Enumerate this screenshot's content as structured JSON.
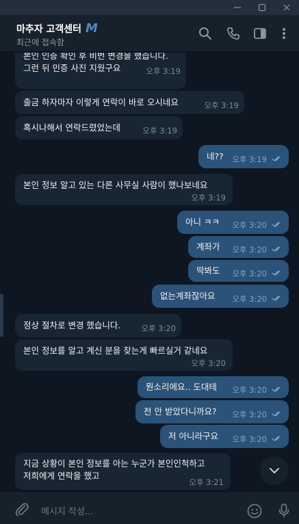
{
  "header": {
    "chat_name": "마추자 고객센터",
    "badge": "M",
    "status": "최근에 접속함"
  },
  "colors": {
    "background": "#0e1621",
    "incoming_bubble": "#182533",
    "outgoing_bubble": "#2b5278",
    "accent": "#5288c1"
  },
  "messages": [
    {
      "text": "본인 인증 확인 후 비번 변경을 했습니다.",
      "time": "",
      "dir": "in"
    },
    {
      "text": "그런 뒤 민증 사진 지웠구요",
      "time": "오후 3:19",
      "dir": "in"
    },
    {
      "text": "출금 하자마자 이렇게 연락이 바로 오시네요",
      "time": "오후 3:19",
      "dir": "in"
    },
    {
      "text": "혹시나해서 연락드렸었는데",
      "time": "오후 3:19",
      "dir": "in"
    },
    {
      "text": "네??",
      "time": "오후 3:19",
      "dir": "out"
    },
    {
      "text": "본인 정보 알고 있는 다른 사무실 사람이 했나보네요",
      "time": "오후 3:19",
      "dir": "in"
    },
    {
      "text": "아니 ㅋㅋ",
      "time": "오후 3:20",
      "dir": "out"
    },
    {
      "text": "계좌가",
      "time": "오후 3:20",
      "dir": "out"
    },
    {
      "text": "딱봐도",
      "time": "오후 3:20",
      "dir": "out"
    },
    {
      "text": "없는계좌잖아요",
      "time": "오후 3:20",
      "dir": "out"
    },
    {
      "text": "정상 절차로 변경 했습니다.",
      "time": "오후 3:20",
      "dir": "in"
    },
    {
      "text": "본인 정보를 알고 계신 분을 찾는게 빠르실거 같네요",
      "time": "오후 3:20",
      "dir": "in"
    },
    {
      "text": "뭔소리에요.. 도대테",
      "time": "오후 3:20",
      "dir": "out"
    },
    {
      "text": "전 안 받았다니까요?",
      "time": "오후 3:20",
      "dir": "out"
    },
    {
      "text": "저 아니라구요",
      "time": "오후 3:20",
      "dir": "out"
    },
    {
      "text": "지금 상황이 본인 정보를 아는 누군가 본인인척하고",
      "time": "",
      "dir": "in"
    },
    {
      "text": "저희에게 연락을 했고",
      "time": "오후 3:21",
      "dir": "in"
    }
  ],
  "composer": {
    "placeholder": "메시지 작성..."
  },
  "icons": [
    "minimize-icon",
    "maximize-icon",
    "close-icon",
    "search-icon",
    "phone-icon",
    "sidebar-icon",
    "more-vert-icon",
    "chevron-down-icon",
    "attach-icon",
    "emoji-icon",
    "mic-icon"
  ]
}
